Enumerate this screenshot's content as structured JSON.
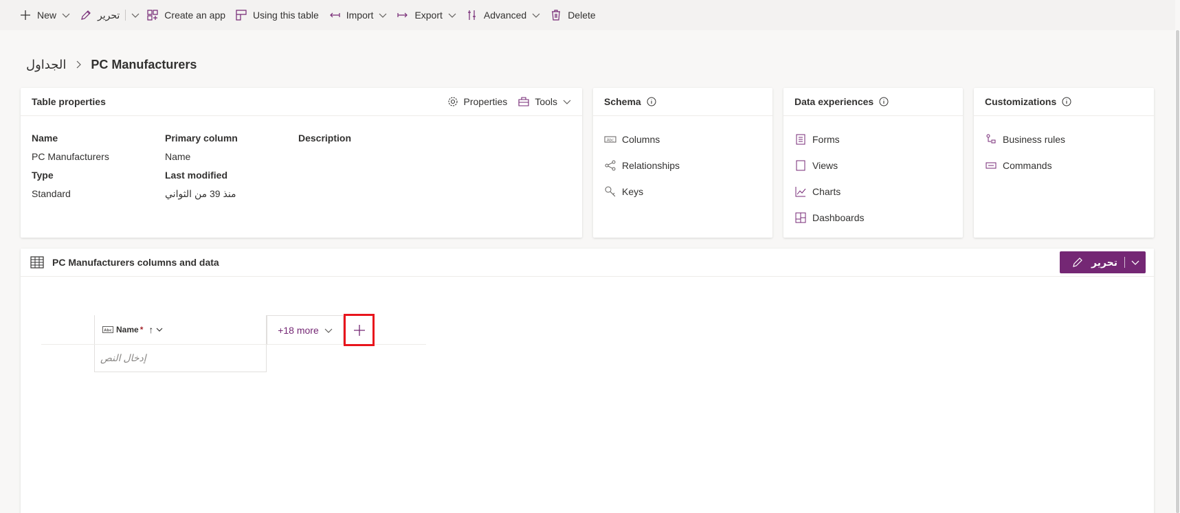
{
  "toolbar": {
    "new_label": "New",
    "edit_label": "تحرير",
    "create_app_label": "Create an app",
    "using_table_label": "Using this table",
    "import_label": "Import",
    "export_label": "Export",
    "advanced_label": "Advanced",
    "delete_label": "Delete"
  },
  "breadcrumb": {
    "root": "الجداول",
    "current": "PC Manufacturers"
  },
  "table_properties": {
    "title": "Table properties",
    "properties_label": "Properties",
    "tools_label": "Tools",
    "name_label": "Name",
    "name_value": "PC Manufacturers",
    "primary_column_label": "Primary column",
    "primary_column_value": "Name",
    "description_label": "Description",
    "type_label": "Type",
    "type_value": "Standard",
    "last_modified_label": "Last modified",
    "last_modified_value": "منذ 39 من الثواني"
  },
  "schema": {
    "title": "Schema",
    "items": [
      "Columns",
      "Relationships",
      "Keys"
    ]
  },
  "data_experiences": {
    "title": "Data experiences",
    "items": [
      "Forms",
      "Views",
      "Charts",
      "Dashboards"
    ]
  },
  "customizations": {
    "title": "Customizations",
    "items": [
      "Business rules",
      "Commands"
    ]
  },
  "data_panel": {
    "title": "PC Manufacturers columns and data",
    "edit_label": "تحرير",
    "name_column_label": "Name",
    "required_marker": "*",
    "sort_indicator": "↑",
    "name_cell_placeholder": "إدخال النص",
    "more_columns_label": "+18 more"
  },
  "colors": {
    "accent": "#742774",
    "highlight_border": "#e8141c"
  }
}
